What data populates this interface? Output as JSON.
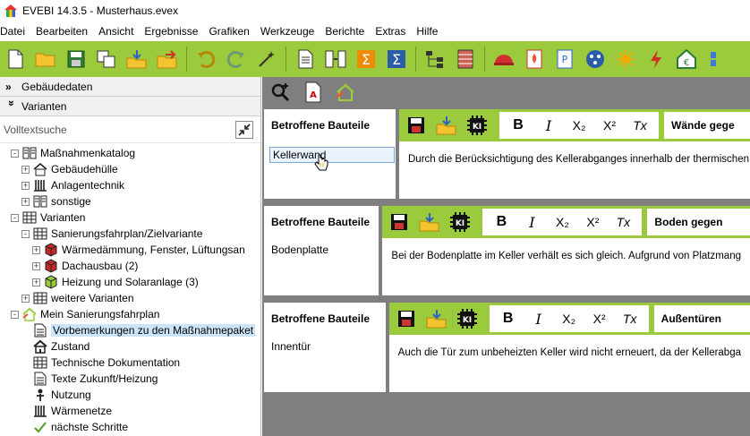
{
  "window": {
    "title": "EVEBI 14.3.5 - Musterhaus.evex"
  },
  "menu": [
    "Datei",
    "Bearbeiten",
    "Ansicht",
    "Ergebnisse",
    "Grafiken",
    "Werkzeuge",
    "Berichte",
    "Extras",
    "Hilfe"
  ],
  "left_panel": {
    "sections": [
      "Gebäudedaten",
      "Varianten"
    ],
    "search_placeholder": "Volltextsuche",
    "tree": [
      {
        "label": "Maßnahmenkatalog",
        "icon": "book-icon",
        "indent": 0,
        "exp": "-"
      },
      {
        "label": "Gebäudehülle",
        "icon": "house-outline-icon",
        "indent": 1,
        "exp": "+"
      },
      {
        "label": "Anlagentechnik",
        "icon": "radiator-icon",
        "indent": 1,
        "exp": "+"
      },
      {
        "label": "sonstige",
        "icon": "book-icon",
        "indent": 1,
        "exp": "+"
      },
      {
        "label": "Varianten",
        "icon": "grid-icon",
        "indent": 0,
        "exp": "-"
      },
      {
        "label": "Sanierungsfahrplan/Zielvariante",
        "icon": "grid-icon",
        "indent": 1,
        "exp": "-"
      },
      {
        "label": "Wärmedämmung, Fenster, Lüftungsan",
        "icon": "red-cube-icon",
        "indent": 2,
        "exp": "+"
      },
      {
        "label": "Dachausbau (2)",
        "icon": "red-cube-icon",
        "indent": 2,
        "exp": "+"
      },
      {
        "label": "Heizung und Solaranlage (3)",
        "icon": "green-cube-icon",
        "indent": 2,
        "exp": "+"
      },
      {
        "label": "weitere Varianten",
        "icon": "grid-icon",
        "indent": 1,
        "exp": "+"
      },
      {
        "label": "Mein Sanierungsfahrplan",
        "icon": "house-roadmap-icon",
        "indent": 0,
        "exp": "-"
      },
      {
        "label": "Vorbemerkungen zu den Maßnahmepaket",
        "icon": "document-icon",
        "indent": 1,
        "exp": "",
        "selected": true
      },
      {
        "label": "Zustand",
        "icon": "house-icon",
        "indent": 1,
        "exp": ""
      },
      {
        "label": "Technische Dokumentation",
        "icon": "grid-icon",
        "indent": 1,
        "exp": ""
      },
      {
        "label": "Texte Zukunft/Heizung",
        "icon": "document-icon",
        "indent": 1,
        "exp": ""
      },
      {
        "label": "Nutzung",
        "icon": "person-icon",
        "indent": 1,
        "exp": ""
      },
      {
        "label": "Wärmenetze",
        "icon": "radiator-icon",
        "indent": 1,
        "exp": ""
      },
      {
        "label": "nächste Schritte",
        "icon": "checkmark-icon",
        "indent": 1,
        "exp": ""
      }
    ]
  },
  "cards": [
    {
      "left_header": "Betroffene Bauteile",
      "bauteil": "Kellerwand",
      "bauteil_editing": true,
      "title": "Wände gege",
      "body": "Durch die Berücksichtigung des Kellerabganges innerhalb der thermischen h"
    },
    {
      "left_header": "Betroffene Bauteile",
      "bauteil": "Bodenplatte",
      "bauteil_editing": false,
      "title": "Boden gegen",
      "body": "Bei der Bodenplatte im Keller verhält es sich gleich. Aufgrund von Platzmang"
    },
    {
      "left_header": "Betroffene Bauteile",
      "bauteil": "Innentür",
      "bauteil_editing": false,
      "title": "Außentüren",
      "body": "Auch die Tür zum unbeheizten Keller wird nicht erneuert, da der Kellerabga"
    }
  ],
  "formatting": {
    "bold": "B",
    "italic": "I",
    "subscript": "X₂",
    "superscript": "X²",
    "clear": "Tx",
    "ki": "KI"
  },
  "colors": {
    "toolbar_green": "#9bcb3c",
    "panel_gray": "#7f7f7f"
  }
}
